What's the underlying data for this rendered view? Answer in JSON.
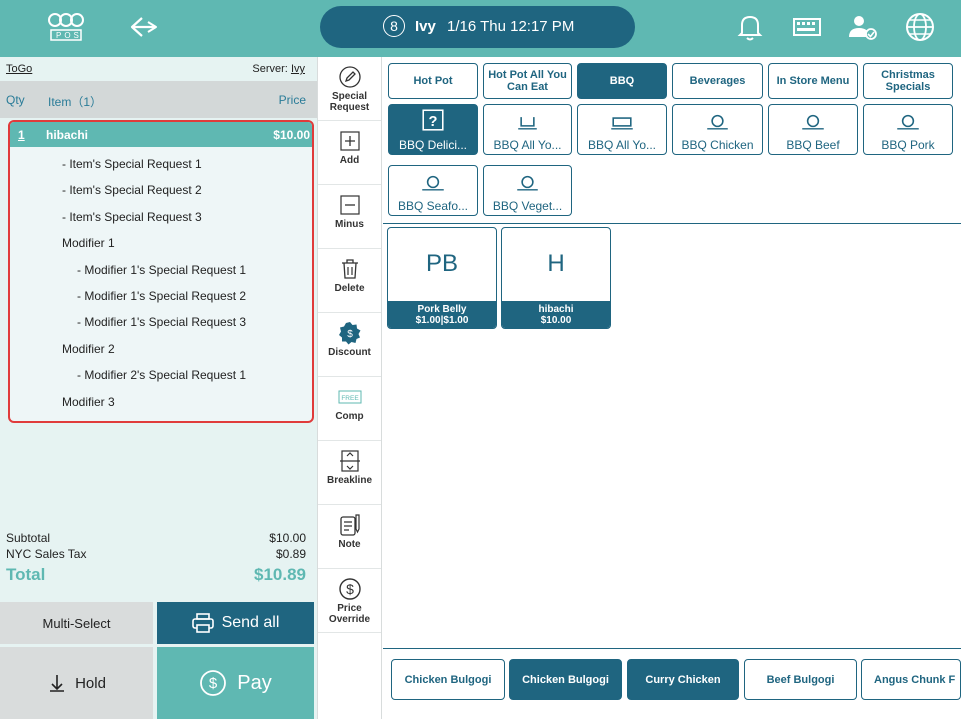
{
  "header": {
    "logo_text": "POS",
    "order_number": "8",
    "user": "Ivy",
    "datetime": "1/16 Thu 12:17 PM"
  },
  "order": {
    "order_type": "ToGo",
    "server_label": "Server:",
    "server_name": "Ivy",
    "col_qty": "Qty",
    "col_item": "Item（1）",
    "col_price": "Price",
    "item": {
      "qty": "1",
      "name": "hibachi",
      "price": "$10.00"
    },
    "lines": [
      "- Item's Special Request 1",
      "- Item's Special Request 2",
      "- Item's Special Request 3",
      "Modifier 1",
      "- Modifier 1's Special Request 1",
      "- Modifier 1's Special Request 2",
      "- Modifier 1's Special Request 3",
      "Modifier 2",
      "- Modifier 2's Special Request 1",
      "Modifier 3"
    ]
  },
  "totals": {
    "subtotal_label": "Subtotal",
    "subtotal": "$10.00",
    "tax_label": "NYC Sales Tax",
    "tax": "$0.89",
    "total_label": "Total",
    "total": "$10.89"
  },
  "actions": {
    "multi_select": "Multi-Select",
    "send_all": "Send all",
    "hold": "Hold",
    "pay": "Pay"
  },
  "tools": [
    {
      "label": "Special\nRequest",
      "icon": "pencil-icon"
    },
    {
      "label": "Add",
      "icon": "plus-icon"
    },
    {
      "label": "Minus",
      "icon": "minus-icon"
    },
    {
      "label": "Delete",
      "icon": "trash-icon"
    },
    {
      "label": "Discount",
      "icon": "discount-icon"
    },
    {
      "label": "Comp",
      "icon": "free-icon",
      "icon_text": "FREE"
    },
    {
      "label": "Breakline",
      "icon": "breakline-icon"
    },
    {
      "label": "Note",
      "icon": "note-icon"
    },
    {
      "label": "Price\nOverride",
      "icon": "dollar-icon"
    }
  ],
  "categories": [
    {
      "label": "Hot Pot",
      "active": false
    },
    {
      "label": "Hot Pot All You Can Eat",
      "active": false
    },
    {
      "label": "BBQ",
      "active": true
    },
    {
      "label": "Beverages",
      "active": false
    },
    {
      "label": "In Store Menu",
      "active": false
    },
    {
      "label": "Christmas Specials",
      "active": false
    }
  ],
  "subcategories": [
    {
      "label": "BBQ Delici...",
      "icon": "question-icon",
      "active": true
    },
    {
      "label": "BBQ All Yo...",
      "icon": "bowl-icon",
      "active": false
    },
    {
      "label": "BBQ All Yo...",
      "icon": "tray-icon",
      "active": false
    },
    {
      "label": "BBQ Chicken",
      "icon": "dish-icon",
      "active": false
    },
    {
      "label": "BBQ Beef",
      "icon": "dish-icon",
      "active": false
    },
    {
      "label": "BBQ Pork",
      "icon": "dish-icon",
      "active": false
    },
    {
      "label": "BBQ Seafo...",
      "icon": "dish-icon",
      "active": false
    },
    {
      "label": "BBQ Veget...",
      "icon": "dish-icon",
      "active": false
    }
  ],
  "products": [
    {
      "abbr": "PB",
      "name": "Pork Belly",
      "price": "$1.00|$1.00"
    },
    {
      "abbr": "H",
      "name": "hibachi",
      "price": "$10.00"
    }
  ],
  "bottom_items": [
    {
      "label": "Chicken Bulgogi",
      "active": false
    },
    {
      "label": "Chicken Bulgogi",
      "active": true
    },
    {
      "label": "Curry Chicken",
      "active": true
    },
    {
      "label": "Beef Bulgogi",
      "active": false
    },
    {
      "label": "Angus Chunk F",
      "active": false
    }
  ],
  "colors": {
    "teal": "#5fb8b2",
    "navy": "#1f6580",
    "highlight_border": "#e03b3b"
  }
}
